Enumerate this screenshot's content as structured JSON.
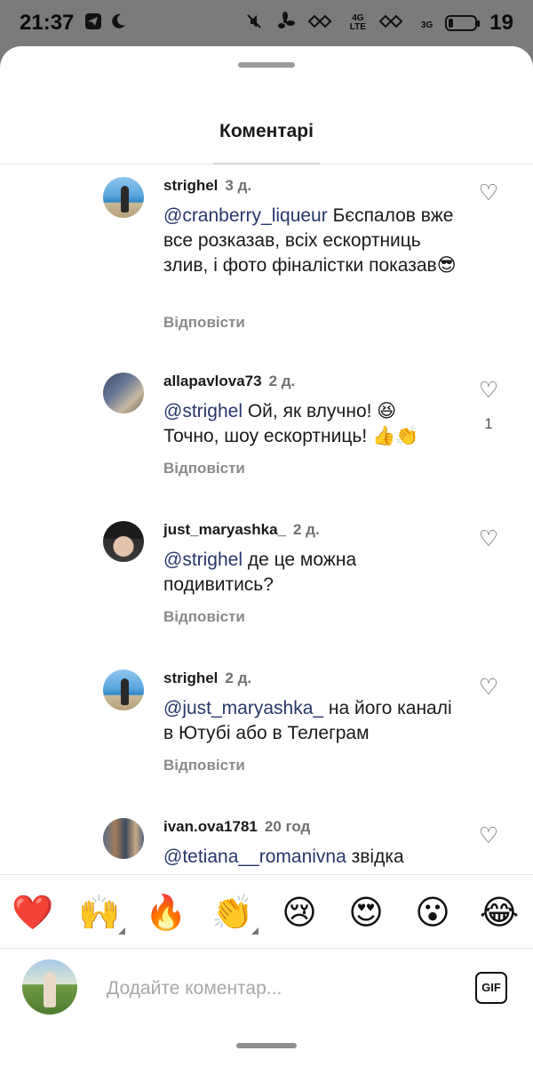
{
  "status_bar": {
    "time": "21:37",
    "net_4g": "4G",
    "net_lte": "LTE",
    "net_3g": "3G",
    "battery": "19",
    "battery_level": 0.19
  },
  "sheet": {
    "title": "Коментарі"
  },
  "comments": [
    {
      "username": "strighel",
      "age": "3 д.",
      "mention": "@cranberry_liqueur",
      "text": " Бєспалов вже все розказав, всіх ескортниць злив, і фото фіналістки показав😎",
      "reply": "Відповісти",
      "likes": ""
    },
    {
      "username": "allapavlova73",
      "age": "2 д.",
      "mention": "@strighel",
      "text": " Ой, як влучно! 😆 Точно, шоу ескортниць! 👍👏",
      "reply": "Відповісти",
      "likes": "1"
    },
    {
      "username": "just_maryashka_",
      "age": "2 д.",
      "mention": "@strighel",
      "text": " де це можна подивитись?",
      "reply": "Відповісти",
      "likes": ""
    },
    {
      "username": "strighel",
      "age": "2 д.",
      "mention": "@just_maryashka_",
      "text": " на його каналі в Ютубі або в Телеграм",
      "reply": "Відповісти",
      "likes": ""
    },
    {
      "username": "ivan.ova1781",
      "age": "20 год",
      "mention": "@tetiana__romanivna",
      "text": " звідка",
      "reply": "",
      "likes": ""
    }
  ],
  "icons": {
    "like": "♡",
    "telegram": "telegram-icon",
    "moon": "moon-icon",
    "mute": "mute-icon",
    "fan": "fan-icon"
  },
  "emoji_bar": [
    "❤️",
    "🙌",
    "🔥",
    "👏",
    "😢",
    "😍",
    "😮",
    "😂"
  ],
  "input": {
    "placeholder": "Додайте коментар...",
    "value": "",
    "gif_label": "GIF"
  },
  "colors": {
    "mention": "#28376b",
    "background": "#ffffff",
    "status_bar": "#7b7b7b"
  }
}
